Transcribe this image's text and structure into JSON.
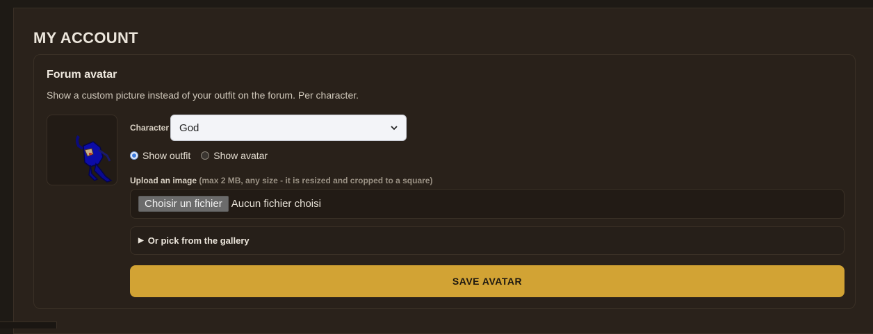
{
  "page": {
    "title": "MY ACCOUNT"
  },
  "forum_avatar": {
    "title": "Forum avatar",
    "description": "Show a custom picture instead of your outfit on the forum. Per character.",
    "character_label": "Character",
    "character_selected": "God",
    "radio_options": [
      {
        "label": "Show outfit",
        "checked": true
      },
      {
        "label": "Show avatar",
        "checked": false
      }
    ],
    "upload_label": "Upload an image",
    "upload_hint": "(max 2 MB, any size - it is resized and cropped to a square)",
    "file_button": "Choisir un fichier",
    "file_status": "Aucun fichier choisi",
    "gallery_label": "Or pick from the gallery",
    "save_label": "SAVE AVATAR",
    "colors": {
      "accent": "#d2a334",
      "panel": "#2a221b",
      "background": "#1e1a15"
    }
  }
}
